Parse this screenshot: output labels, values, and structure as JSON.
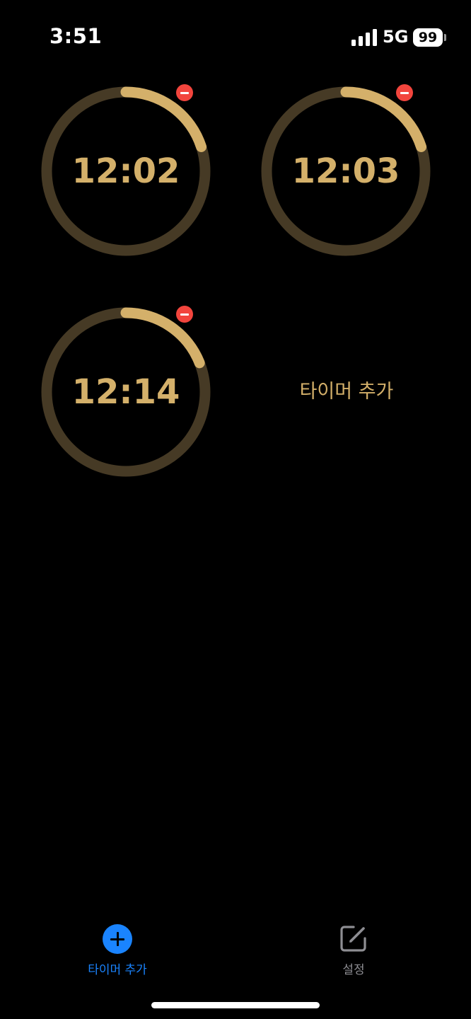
{
  "status_bar": {
    "time": "3:51",
    "network": "5G",
    "battery": "99"
  },
  "timers": [
    {
      "label": "12:02",
      "progress": 0.2
    },
    {
      "label": "12:03",
      "progress": 0.2
    },
    {
      "label": "12:14",
      "progress": 0.19
    }
  ],
  "add_timer": {
    "label": "타이머 추가"
  },
  "tab_bar": {
    "add_label": "타이머 추가",
    "settings_label": "설정"
  },
  "colors": {
    "accent": "#d4b06a",
    "ring_track": "#463a25",
    "remove": "#f2453d",
    "tab_active": "#1a84ff",
    "tab_inactive": "#8e8e93"
  }
}
